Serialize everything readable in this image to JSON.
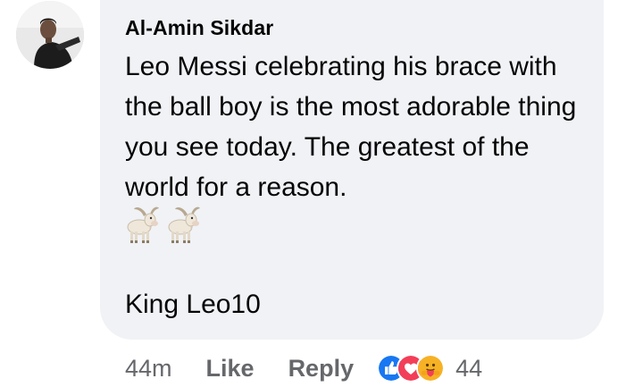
{
  "comment": {
    "author": "Al-Amin Sikdar",
    "body": "Leo Messi celebrating his brace with the ball boy is the most adorable thing you see today. The greatest of the world for a reason.",
    "emoji_icons": [
      "goat-emoji",
      "goat-emoji"
    ],
    "signoff": "King Leo10"
  },
  "actions": {
    "timestamp": "44m",
    "like_label": "Like",
    "reply_label": "Reply",
    "reaction_icons": [
      "like-reaction-icon",
      "love-reaction-icon",
      "care-reaction-icon"
    ],
    "reaction_count": "44"
  },
  "colors": {
    "bubble": "#f0f2f5",
    "meta_text": "#65676b",
    "like_blue": "#1877f2",
    "love_red": "#f33e58",
    "care_yellow": "#f7b125"
  }
}
